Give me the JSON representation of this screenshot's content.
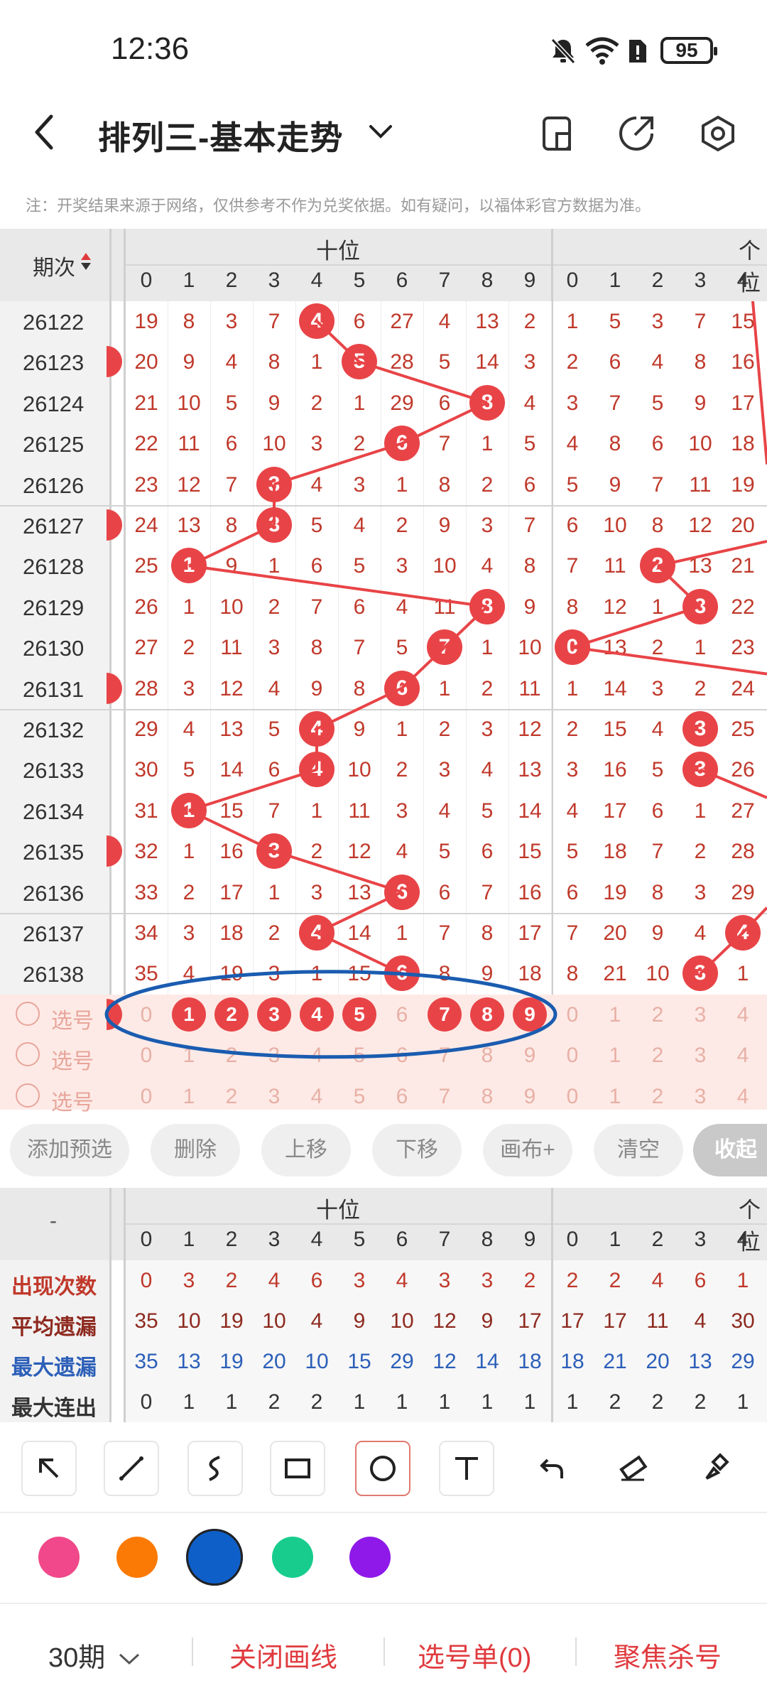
{
  "status": {
    "time": "12:36",
    "battery": "95"
  },
  "header": {
    "title": "排列三-基本走势"
  },
  "note": "注：开奖结果来源于网络，仅供参考不作为兑奖依据。如有疑问，以福体彩官方数据为准。",
  "grid": {
    "period_header": "期次",
    "tens_header": "十位",
    "units_header": "个位",
    "digits": [
      "0",
      "1",
      "2",
      "3",
      "4",
      "5",
      "6",
      "7",
      "8",
      "9"
    ],
    "units_digits": [
      "0",
      "1",
      "2",
      "3",
      "4"
    ],
    "rows": [
      {
        "period": "26122",
        "tens": [
          "19",
          "8",
          "3",
          "7",
          "4",
          "6",
          "27",
          "4",
          "13",
          "2"
        ],
        "tens_hit": 4,
        "units": [
          "1",
          "5",
          "3",
          "7",
          "15"
        ],
        "units_hit": -1
      },
      {
        "period": "26123",
        "tens": [
          "20",
          "9",
          "4",
          "8",
          "1",
          "5",
          "28",
          "5",
          "14",
          "3"
        ],
        "tens_hit": 5,
        "units": [
          "2",
          "6",
          "4",
          "8",
          "16"
        ],
        "units_hit": -1
      },
      {
        "period": "26124",
        "tens": [
          "21",
          "10",
          "5",
          "9",
          "2",
          "1",
          "29",
          "6",
          "8",
          "4"
        ],
        "tens_hit": 8,
        "units": [
          "3",
          "7",
          "5",
          "9",
          "17"
        ],
        "units_hit": -1
      },
      {
        "period": "26125",
        "tens": [
          "22",
          "11",
          "6",
          "10",
          "3",
          "2",
          "6",
          "7",
          "1",
          "5"
        ],
        "tens_hit": 6,
        "units": [
          "4",
          "8",
          "6",
          "10",
          "18"
        ],
        "units_hit": -1
      },
      {
        "period": "26126",
        "tens": [
          "23",
          "12",
          "7",
          "3",
          "4",
          "3",
          "1",
          "8",
          "2",
          "6"
        ],
        "tens_hit": 3,
        "units": [
          "5",
          "9",
          "7",
          "11",
          "19"
        ],
        "units_hit": -1
      },
      {
        "period": "26127",
        "tens": [
          "24",
          "13",
          "8",
          "3",
          "5",
          "4",
          "2",
          "9",
          "3",
          "7"
        ],
        "tens_hit": 3,
        "units": [
          "6",
          "10",
          "8",
          "12",
          "20"
        ],
        "units_hit": -1
      },
      {
        "period": "26128",
        "tens": [
          "25",
          "1",
          "9",
          "1",
          "6",
          "5",
          "3",
          "10",
          "4",
          "8"
        ],
        "tens_hit": 1,
        "units": [
          "7",
          "11",
          "2",
          "13",
          "21"
        ],
        "units_hit": 2
      },
      {
        "period": "26129",
        "tens": [
          "26",
          "1",
          "10",
          "2",
          "7",
          "6",
          "4",
          "11",
          "8",
          "9"
        ],
        "tens_hit": 8,
        "units": [
          "8",
          "12",
          "1",
          "3",
          "22"
        ],
        "units_hit": 3
      },
      {
        "period": "26130",
        "tens": [
          "27",
          "2",
          "11",
          "3",
          "8",
          "7",
          "5",
          "7",
          "1",
          "10"
        ],
        "tens_hit": 7,
        "units": [
          "0",
          "13",
          "2",
          "1",
          "23"
        ],
        "units_hit": 0
      },
      {
        "period": "26131",
        "tens": [
          "28",
          "3",
          "12",
          "4",
          "9",
          "8",
          "6",
          "1",
          "2",
          "11"
        ],
        "tens_hit": 6,
        "units": [
          "1",
          "14",
          "3",
          "2",
          "24"
        ],
        "units_hit": -1
      },
      {
        "period": "26132",
        "tens": [
          "29",
          "4",
          "13",
          "5",
          "4",
          "9",
          "1",
          "2",
          "3",
          "12"
        ],
        "tens_hit": 4,
        "units": [
          "2",
          "15",
          "4",
          "3",
          "25"
        ],
        "units_hit": 3
      },
      {
        "period": "26133",
        "tens": [
          "30",
          "5",
          "14",
          "6",
          "4",
          "10",
          "2",
          "3",
          "4",
          "13"
        ],
        "tens_hit": 4,
        "units": [
          "3",
          "16",
          "5",
          "3",
          "26"
        ],
        "units_hit": 3
      },
      {
        "period": "26134",
        "tens": [
          "31",
          "1",
          "15",
          "7",
          "1",
          "11",
          "3",
          "4",
          "5",
          "14"
        ],
        "tens_hit": 1,
        "units": [
          "4",
          "17",
          "6",
          "1",
          "27"
        ],
        "units_hit": -1
      },
      {
        "period": "26135",
        "tens": [
          "32",
          "1",
          "16",
          "3",
          "2",
          "12",
          "4",
          "5",
          "6",
          "15"
        ],
        "tens_hit": 3,
        "units": [
          "5",
          "18",
          "7",
          "2",
          "28"
        ],
        "units_hit": -1
      },
      {
        "period": "26136",
        "tens": [
          "33",
          "2",
          "17",
          "1",
          "3",
          "13",
          "6",
          "6",
          "7",
          "16"
        ],
        "tens_hit": 6,
        "units": [
          "6",
          "19",
          "8",
          "3",
          "29"
        ],
        "units_hit": -1
      },
      {
        "period": "26137",
        "tens": [
          "34",
          "3",
          "18",
          "2",
          "4",
          "14",
          "1",
          "7",
          "8",
          "17"
        ],
        "tens_hit": 4,
        "units": [
          "7",
          "20",
          "9",
          "4",
          "4"
        ],
        "units_hit": 4
      },
      {
        "period": "26138",
        "tens": [
          "35",
          "4",
          "19",
          "3",
          "1",
          "15",
          "6",
          "8",
          "9",
          "18"
        ],
        "tens_hit": 6,
        "units": [
          "8",
          "21",
          "10",
          "3",
          "1"
        ],
        "units_hit": 3
      }
    ],
    "select_label": "选号",
    "selected_digits": [
      1,
      2,
      3,
      4,
      5,
      7,
      8,
      9
    ]
  },
  "actions": [
    "添加预选",
    "删除",
    "上移",
    "下移",
    "画布+",
    "清空",
    "收起"
  ],
  "stats": {
    "corner": "-",
    "tens_header": "十位",
    "units_header": "个位",
    "rows": [
      {
        "label": "出现次数",
        "color": "#c0392b",
        "tens": [
          "0",
          "3",
          "2",
          "4",
          "6",
          "3",
          "4",
          "3",
          "3",
          "2"
        ],
        "units": [
          "2",
          "2",
          "4",
          "6",
          "1"
        ]
      },
      {
        "label": "平均遗漏",
        "color": "#8e2a1f",
        "tens": [
          "35",
          "10",
          "19",
          "10",
          "4",
          "9",
          "10",
          "12",
          "9",
          "17"
        ],
        "units": [
          "17",
          "17",
          "11",
          "4",
          "30"
        ]
      },
      {
        "label": "最大遗漏",
        "color": "#2c5fb8",
        "tens": [
          "35",
          "13",
          "19",
          "20",
          "10",
          "15",
          "29",
          "12",
          "14",
          "18"
        ],
        "units": [
          "18",
          "21",
          "20",
          "13",
          "29"
        ]
      },
      {
        "label": "最大连出",
        "color": "#333333",
        "tens": [
          "0",
          "1",
          "1",
          "2",
          "2",
          "1",
          "1",
          "1",
          "1",
          "1"
        ],
        "units": [
          "1",
          "2",
          "2",
          "2",
          "1"
        ]
      }
    ]
  },
  "tools": [
    "arrow-tool-icon",
    "line-tool-icon",
    "freehand-tool-icon",
    "rectangle-tool-icon",
    "circle-tool-icon",
    "text-tool-icon",
    "undo-icon",
    "eraser-icon",
    "brush-icon"
  ],
  "colors": [
    "#f0488a",
    "#fb7a05",
    "#0f5fc9",
    "#18cc8e",
    "#8e19e8"
  ],
  "bottom": {
    "periods": "30期",
    "close_draw": "关闭画线",
    "pick_list": "选号单(0)",
    "focus_kill": "聚焦杀号"
  }
}
